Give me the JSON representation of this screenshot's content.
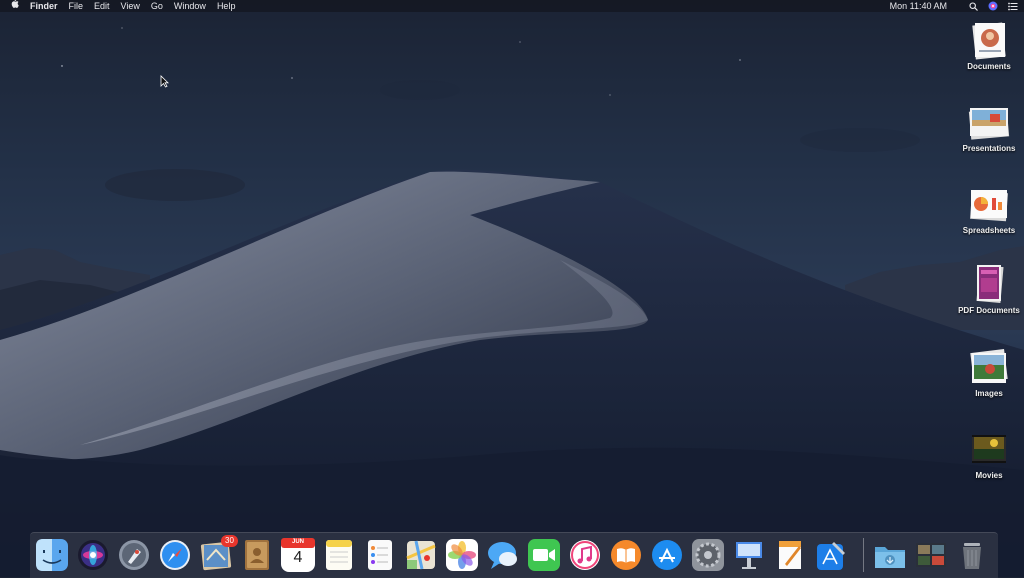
{
  "menubar": {
    "apple_icon": "apple-logo-icon",
    "app_name": "Finder",
    "menus": [
      "File",
      "Edit",
      "View",
      "Go",
      "Window",
      "Help"
    ],
    "clock": "Mon 11:40 AM",
    "status_icons": [
      "search-icon",
      "siri-icon",
      "notification-center-icon"
    ]
  },
  "desktop": {
    "icons": [
      {
        "label": "Documents"
      },
      {
        "label": "Presentations"
      },
      {
        "label": "Spreadsheets"
      },
      {
        "label": "PDF Documents"
      },
      {
        "label": "Images"
      },
      {
        "label": "Movies"
      }
    ]
  },
  "dock": {
    "apps": [
      "Finder",
      "Siri",
      "Launchpad",
      "Safari",
      "Mail",
      "Contacts",
      "Calendar",
      "Notes",
      "Reminders",
      "Maps",
      "Photos",
      "Messages",
      "FaceTime",
      "iTunes",
      "iBooks",
      "App Store",
      "System Preferences",
      "Keynote",
      "Pages",
      "Xcode"
    ],
    "mail_badge": "30",
    "calendar_month": "JUN",
    "calendar_day": "4",
    "stacks": [
      "Downloads",
      "Recent Images",
      "Trash"
    ]
  },
  "colors": {
    "badge": "#e8352c",
    "menubar": "#141822"
  }
}
